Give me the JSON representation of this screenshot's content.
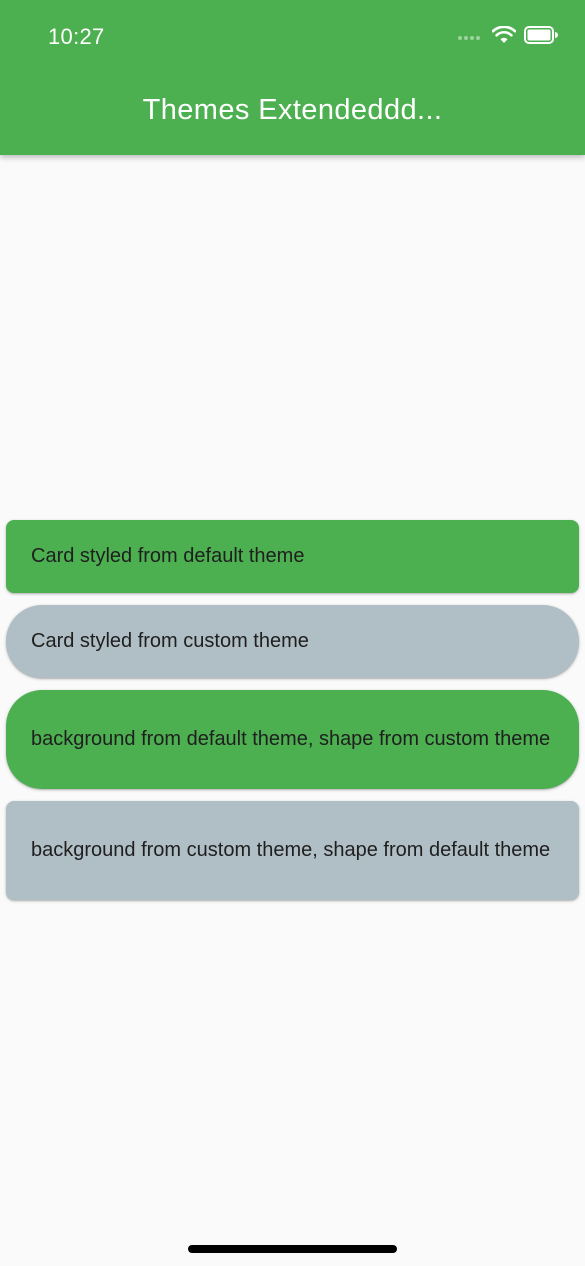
{
  "status_bar": {
    "time": "10:27",
    "icons": [
      "signal-dots-icon",
      "wifi-icon",
      "battery-icon"
    ]
  },
  "app_bar": {
    "title": "Themes Extendeddd...",
    "background_color": "#4caf50"
  },
  "cards": [
    {
      "text": "Card styled from default theme",
      "background_color": "#4caf50"
    },
    {
      "text": "Card styled from custom theme",
      "background_color": "#b0bec5"
    },
    {
      "text": "background from default theme, shape from custom theme",
      "background_color": "#4caf50"
    },
    {
      "text": "background from custom theme, shape from default theme",
      "background_color": "#b0bec5"
    }
  ],
  "colors": {
    "page_background": "#fafafa",
    "default_theme": "#4caf50",
    "custom_theme": "#b0bec5",
    "text": "#1f1f1f"
  }
}
